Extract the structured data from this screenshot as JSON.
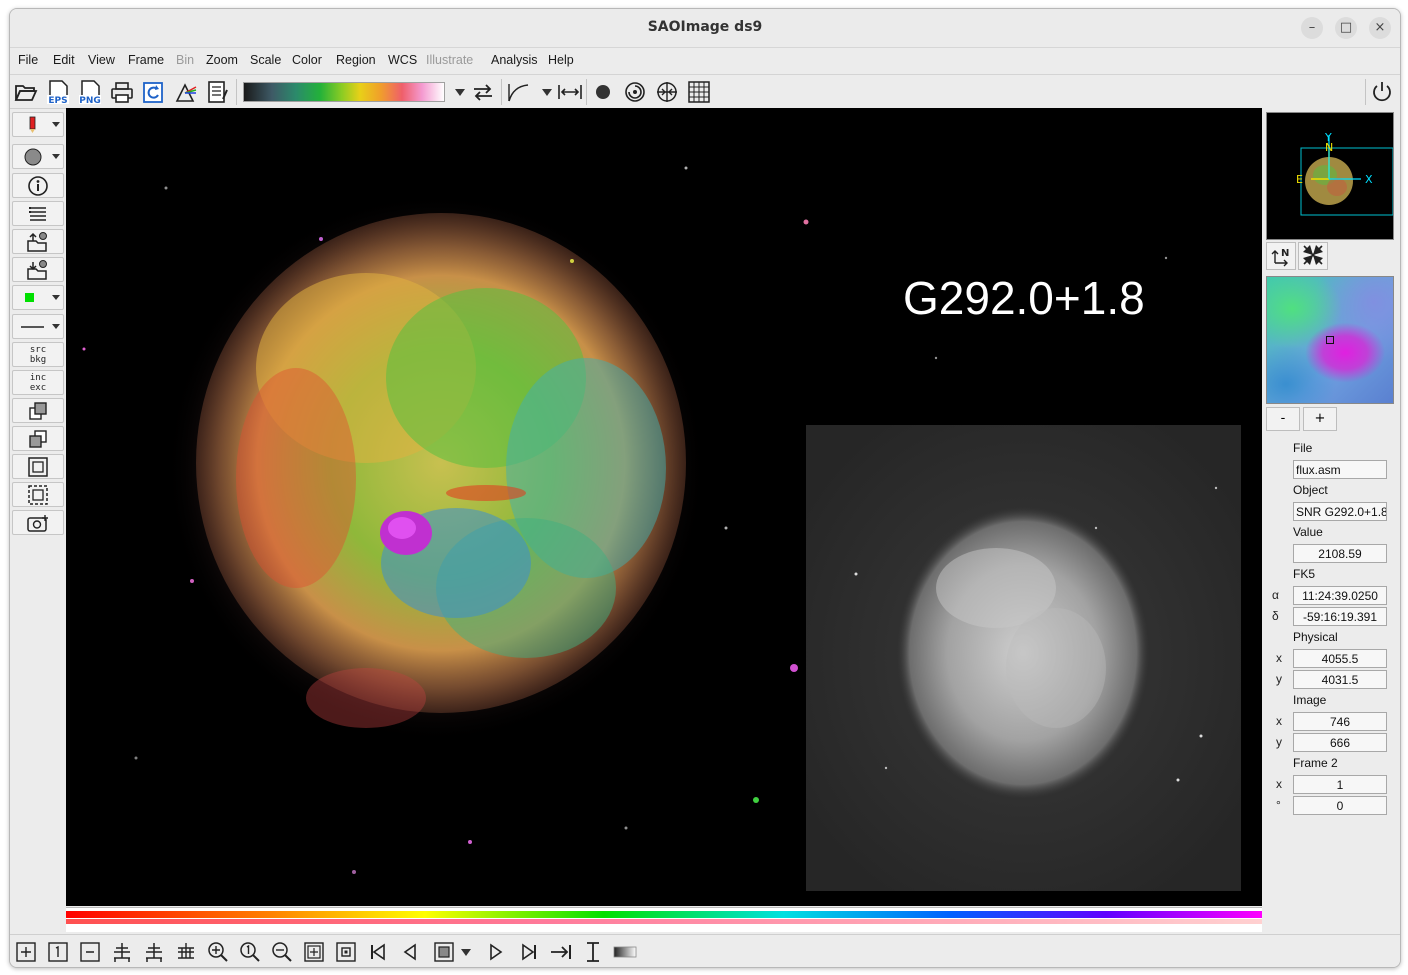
{
  "window": {
    "title": "SAOImage ds9",
    "minimize": "–",
    "maximize": "□",
    "close": "×"
  },
  "menu": [
    "File",
    "Edit",
    "View",
    "Frame",
    "Bin",
    "Zoom",
    "Scale",
    "Color",
    "Region",
    "WCS",
    "Illustrate",
    "Analysis",
    "Help"
  ],
  "disabled_menus": [
    "Bin",
    "Illustrate"
  ],
  "toolbar": {
    "eps_label": "EPS",
    "png_label": "PNG",
    "colorbar_gradient": [
      "#1a1a1a",
      "#3e5a66",
      "#23b13a",
      "#e8d018",
      "#ef5f6a",
      "#ffffff"
    ]
  },
  "left_tools": {
    "src_bkg": [
      "src",
      "bkg"
    ],
    "inc_exc": [
      "inc",
      "exc"
    ],
    "region_color": "#00e000"
  },
  "canvas": {
    "overlay_text": "G292.0+1.8"
  },
  "panner": {
    "compass_n": "N",
    "compass_e": "E",
    "axis_x": "X",
    "axis_y": "Y",
    "compass_color": "#f0e000",
    "axis_color": "#00e0ff"
  },
  "magnifier": {
    "zoom_out": "-",
    "zoom_in": "+"
  },
  "info": {
    "file_label": "File",
    "file_value": "flux.asm",
    "object_label": "Object",
    "object_value": "SNR G292.0+1.8",
    "value_label": "Value",
    "value_value": "2108.59",
    "wcs_label": "FK5",
    "alpha_symbol": "α",
    "alpha_value": "11:24:39.0250",
    "delta_symbol": "δ",
    "delta_value": "-59:16:19.391",
    "physical_label": "Physical",
    "physical_x": "4055.5",
    "physical_y": "4031.5",
    "image_label": "Image",
    "image_x": "746",
    "image_y": "666",
    "frame_label": "Frame 2",
    "frame_x": "1",
    "frame_angle": "0",
    "x_label": "x",
    "y_label": "y",
    "degree_label": "°"
  }
}
